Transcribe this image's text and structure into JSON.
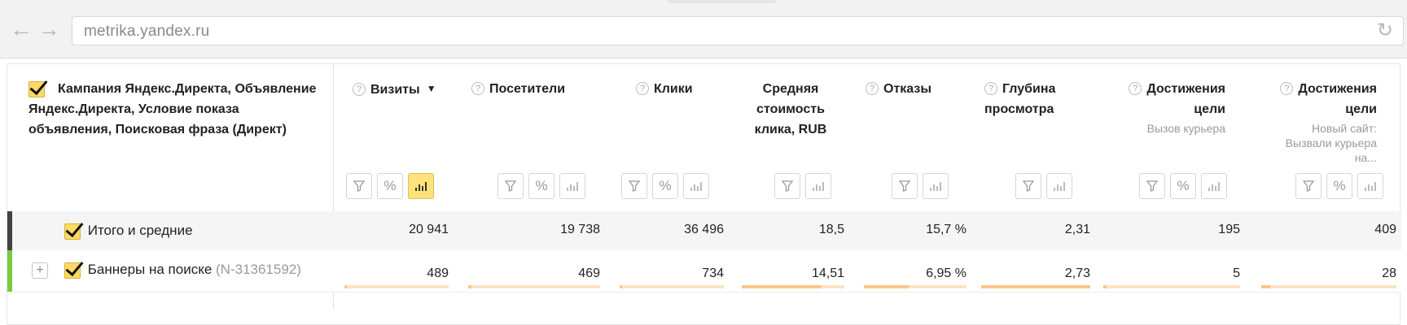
{
  "browser": {
    "url": "metrika.yandex.ru",
    "back_icon": "arrow-left-icon",
    "forward_icon": "arrow-right-icon",
    "reload_icon": "reload-icon"
  },
  "report": {
    "dimension_header": "Кампания Яндекс.Директа, Объявление Яндекс.Директа, Условие показа объявления, Поисковая фраза (Директ)",
    "columns": [
      {
        "title": "Визиты",
        "sort_indicator": "▼",
        "help": "?"
      },
      {
        "title": "Посетители",
        "help": "?"
      },
      {
        "title": "Клики",
        "help": "?"
      },
      {
        "title": "Средняя стоимость клика, RUB"
      },
      {
        "title": "Отказы",
        "help": "?"
      },
      {
        "title": "Глубина просмотра",
        "help": "?"
      },
      {
        "title": "Достижения цели",
        "subtitle": "Вызов курьера",
        "help": "?"
      },
      {
        "title": "Достижения цели",
        "subtitle": "Новый сайт: Вызвали курьера на...",
        "help": "?"
      }
    ],
    "controls": {
      "filter": "filter-icon",
      "percent": "%",
      "chart": "bar-chart-icon"
    },
    "rows": {
      "total": {
        "label": "Итого и средние",
        "values": [
          "20 941",
          "19 738",
          "36 496",
          "18,5",
          "15,7 %",
          "2,31",
          "195",
          "409"
        ]
      },
      "banner": {
        "expand": "+",
        "label": "Баннеры на поиске",
        "id": "(N-31361592)",
        "values": [
          "489",
          "469",
          "734",
          "14,51",
          "6,95 %",
          "2,73",
          "5",
          "28"
        ],
        "share_of_total": [
          0.023,
          0.024,
          0.02,
          0.78,
          0.44,
          1.0,
          0.026,
          0.068
        ]
      }
    },
    "colors": {
      "accent_yellow": "#ffd966",
      "active_button": "#ffe27a",
      "total_marker": "#444444",
      "row_marker": "#7ac943",
      "bar_track": "#fde3c4",
      "bar_fill": "#fcc58c"
    }
  }
}
